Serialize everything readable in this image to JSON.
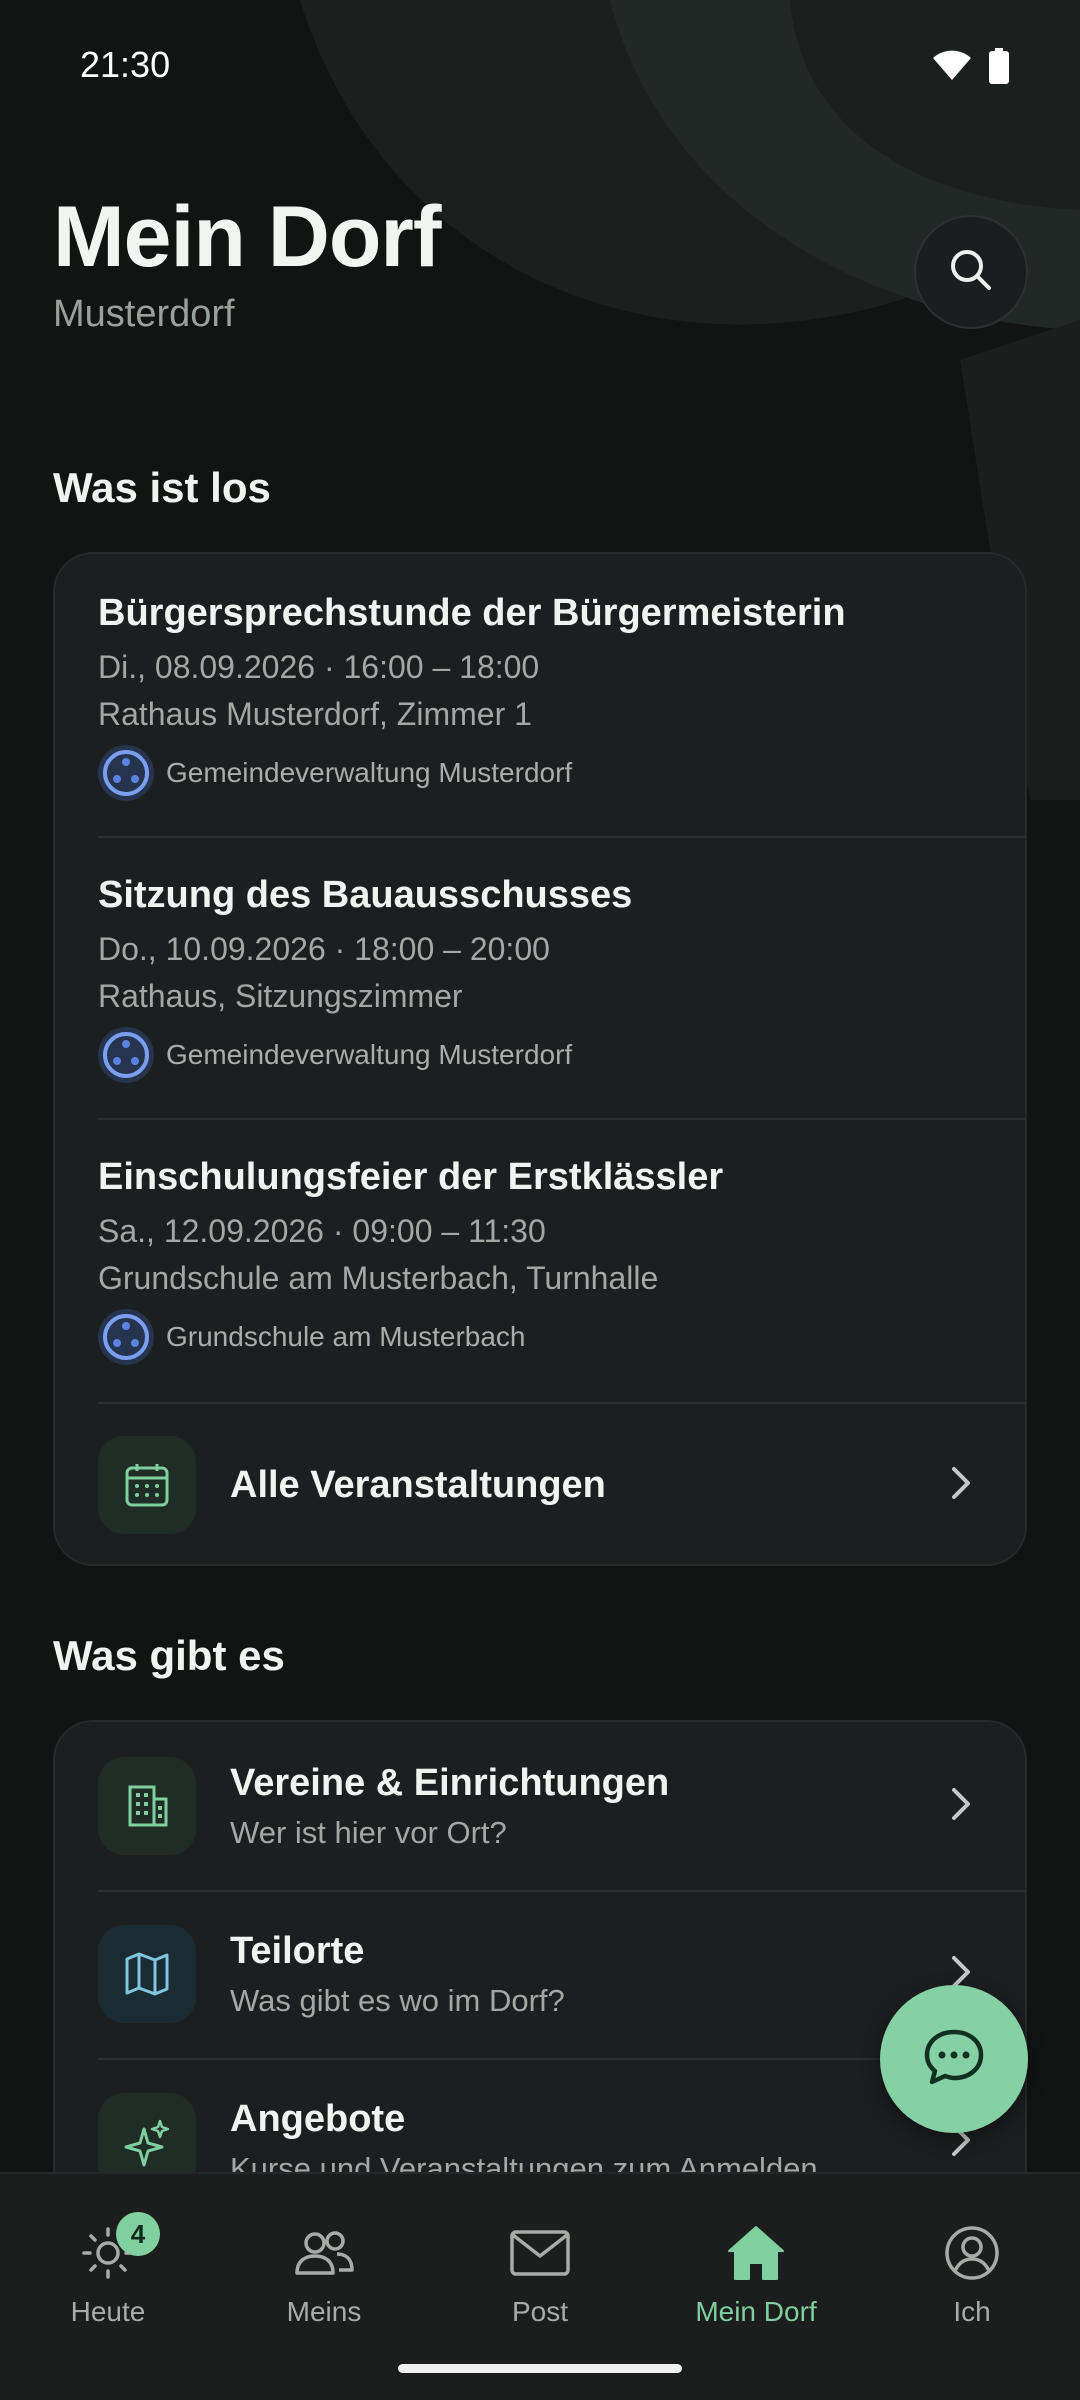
{
  "status": {
    "time": "21:30"
  },
  "header": {
    "title": "Mein Dorf",
    "subtitle": "Musterdorf"
  },
  "section_events": {
    "title": "Was ist los",
    "events": [
      {
        "title": "Bürgersprechstunde der Bürgermeisterin",
        "datetime": "Di., 08.09.2026 · 16:00 – 18:00",
        "location": "Rathaus Musterdorf, Zimmer 1",
        "organizer": "Gemeindeverwaltung Musterdorf"
      },
      {
        "title": "Sitzung des Bauausschusses",
        "datetime": "Do., 10.09.2026 · 18:00 – 20:00",
        "location": "Rathaus, Sitzungszimmer",
        "organizer": "Gemeindeverwaltung Musterdorf"
      },
      {
        "title": "Einschulungsfeier der Erstklässler",
        "datetime": "Sa., 12.09.2026 · 09:00 – 11:30",
        "location": "Grundschule am Musterbach, Turnhalle",
        "organizer": "Grundschule am Musterbach"
      }
    ],
    "all_events_label": "Alle Veranstaltungen"
  },
  "section_offers": {
    "title": "Was gibt es",
    "items": [
      {
        "title": "Vereine & Einrichtungen",
        "subtitle": "Wer ist hier vor Ort?",
        "icon": "building-icon"
      },
      {
        "title": "Teilorte",
        "subtitle": "Was gibt es wo im Dorf?",
        "icon": "map-icon"
      },
      {
        "title": "Angebote",
        "subtitle": "Kurse und Veranstaltungen zum Anmelden",
        "icon": "sparkles-icon"
      }
    ]
  },
  "nav": {
    "items": [
      {
        "label": "Heute",
        "icon": "sun-icon",
        "badge": "4"
      },
      {
        "label": "Meins",
        "icon": "people-icon"
      },
      {
        "label": "Post",
        "icon": "mail-icon"
      },
      {
        "label": "Mein Dorf",
        "icon": "home-icon",
        "active": true
      },
      {
        "label": "Ich",
        "icon": "profile-icon"
      }
    ]
  },
  "colors": {
    "accent": "#7fcf9f",
    "fab": "#86d0a5",
    "background": "#121414",
    "card": "#1c1f1f"
  }
}
